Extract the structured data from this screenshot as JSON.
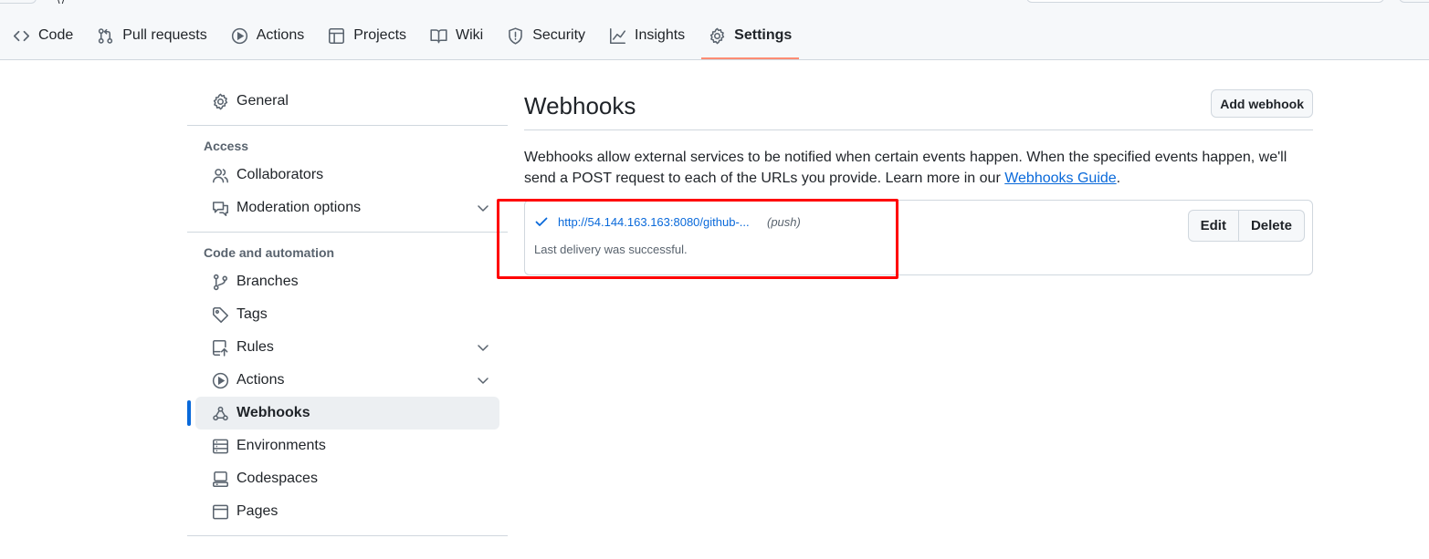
{
  "repo_nav": {
    "tabs": [
      {
        "label": "Code",
        "icon": "code-icon",
        "active": false
      },
      {
        "label": "Pull requests",
        "icon": "pull-request-icon",
        "active": false
      },
      {
        "label": "Actions",
        "icon": "play-icon",
        "active": false
      },
      {
        "label": "Projects",
        "icon": "table-icon",
        "active": false
      },
      {
        "label": "Wiki",
        "icon": "book-icon",
        "active": false
      },
      {
        "label": "Security",
        "icon": "shield-icon",
        "active": false
      },
      {
        "label": "Insights",
        "icon": "graph-icon",
        "active": false
      },
      {
        "label": "Settings",
        "icon": "gear-icon",
        "active": true
      }
    ]
  },
  "sidebar": {
    "general": {
      "label": "General",
      "icon": "gear-icon"
    },
    "access": {
      "heading": "Access",
      "items": [
        {
          "label": "Collaborators",
          "icon": "people-icon",
          "expandable": false
        },
        {
          "label": "Moderation options",
          "icon": "comment-discussion-icon",
          "expandable": true
        }
      ]
    },
    "code_automation": {
      "heading": "Code and automation",
      "items": [
        {
          "label": "Branches",
          "icon": "git-branch-icon",
          "expandable": false
        },
        {
          "label": "Tags",
          "icon": "tag-icon",
          "expandable": false
        },
        {
          "label": "Rules",
          "icon": "repo-push-icon",
          "expandable": true
        },
        {
          "label": "Actions",
          "icon": "play-icon",
          "expandable": true
        },
        {
          "label": "Webhooks",
          "icon": "webhook-icon",
          "expandable": false,
          "active": true
        },
        {
          "label": "Environments",
          "icon": "server-icon",
          "expandable": false
        },
        {
          "label": "Codespaces",
          "icon": "codespaces-icon",
          "expandable": false
        },
        {
          "label": "Pages",
          "icon": "browser-icon",
          "expandable": false
        }
      ]
    }
  },
  "main": {
    "title": "Webhooks",
    "add_button": "Add webhook",
    "description_text": "Webhooks allow external services to be notified when certain events happen. When the specified events happen, we'll send a POST request to each of the URLs you provide. Learn more in our ",
    "guide_link": "Webhooks Guide",
    "description_end": ".",
    "webhooks": [
      {
        "url": "http://54.144.163.163:8080/github-...",
        "event": "(push)",
        "status": "Last delivery was successful.",
        "edit_label": "Edit",
        "delete_label": "Delete"
      }
    ]
  },
  "colors": {
    "accent": "#0969da",
    "success": "#1a7f37",
    "active_tab_underline": "#fd8c73",
    "highlight_box": "#ff0000"
  }
}
